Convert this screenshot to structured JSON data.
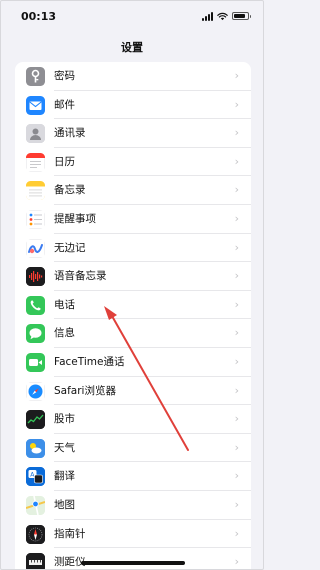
{
  "status_bar": {
    "time": "00:13",
    "battery_level": 0.85
  },
  "nav": {
    "title": "设置"
  },
  "settings": {
    "items": [
      {
        "label": "密码",
        "icon": "key-icon",
        "color": "#8e8e93"
      },
      {
        "label": "邮件",
        "icon": "mail-icon",
        "color": "#1f86ff"
      },
      {
        "label": "通讯录",
        "icon": "contacts-icon",
        "color": "#c9c9ce"
      },
      {
        "label": "日历",
        "icon": "calendar-icon",
        "color": "#ffffff"
      },
      {
        "label": "备忘录",
        "icon": "notes-icon",
        "color": "#ffd54a"
      },
      {
        "label": "提醒事项",
        "icon": "reminders-icon",
        "color": "#ffffff"
      },
      {
        "label": "无边记",
        "icon": "freeform-icon",
        "color": "#ffffff"
      },
      {
        "label": "语音备忘录",
        "icon": "voice-memos-icon",
        "color": "#1c1c1e"
      },
      {
        "label": "电话",
        "icon": "phone-icon",
        "color": "#34c759"
      },
      {
        "label": "信息",
        "icon": "messages-icon",
        "color": "#34c759"
      },
      {
        "label": "FaceTime通话",
        "icon": "facetime-icon",
        "color": "#34c759"
      },
      {
        "label": "Safari浏览器",
        "icon": "safari-icon",
        "color": "#ffffff"
      },
      {
        "label": "股市",
        "icon": "stocks-icon",
        "color": "#1c1c1e"
      },
      {
        "label": "天气",
        "icon": "weather-icon",
        "color": "#4aa3f5"
      },
      {
        "label": "翻译",
        "icon": "translate-icon",
        "color": "#0b6bd8"
      },
      {
        "label": "地图",
        "icon": "maps-icon",
        "color": "#e9f3e6"
      },
      {
        "label": "指南针",
        "icon": "compass-icon",
        "color": "#1c1c1e"
      },
      {
        "label": "测距仪",
        "icon": "measure-icon",
        "color": "#1c1c1e"
      }
    ],
    "chevron": "›"
  },
  "annotation": {
    "color": "#e0403a"
  }
}
